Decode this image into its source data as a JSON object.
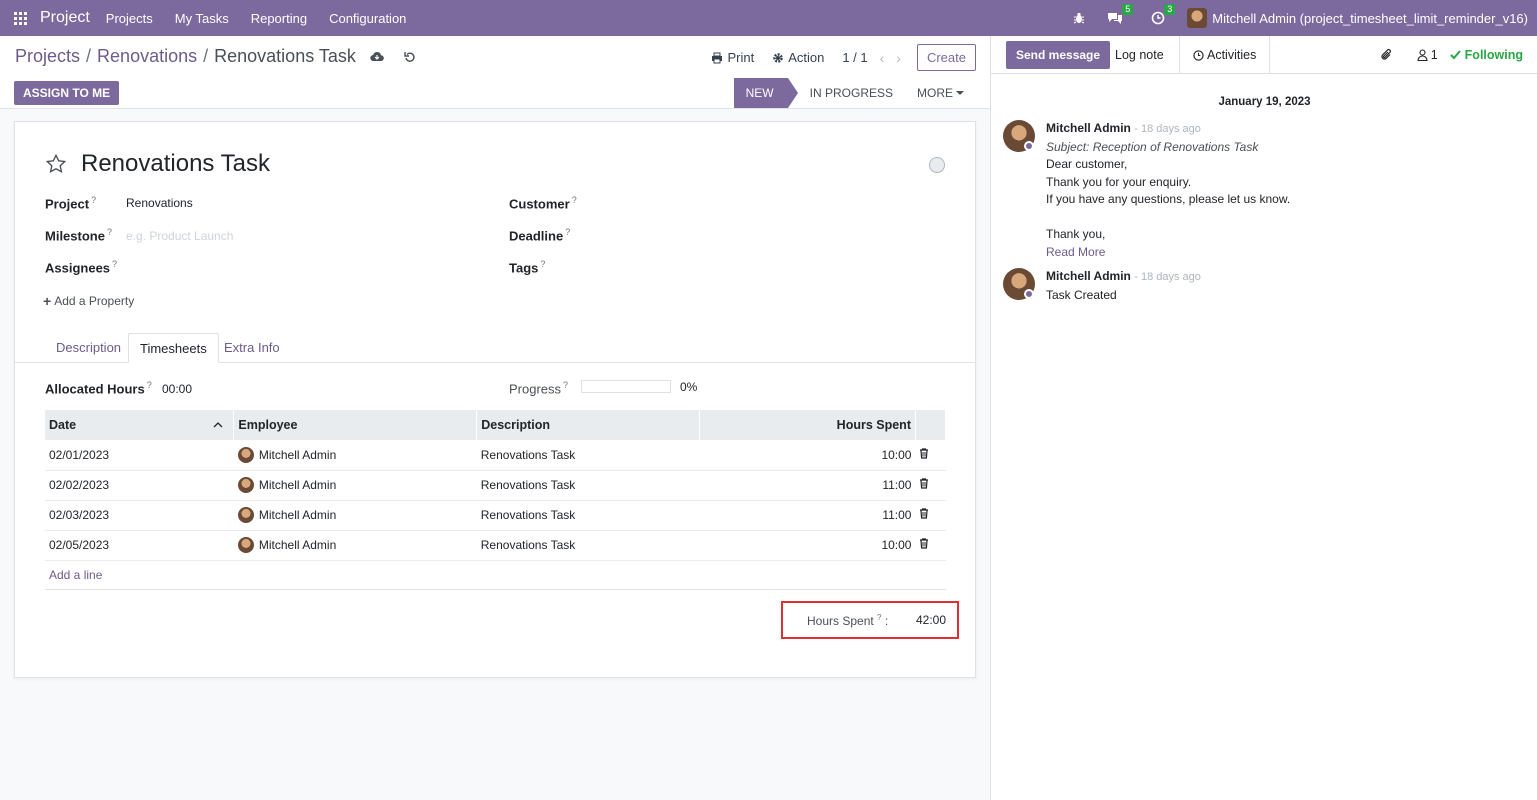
{
  "navbar": {
    "brand": "Project",
    "menu": [
      "Projects",
      "My Tasks",
      "Reporting",
      "Configuration"
    ],
    "messages_badge": "5",
    "activities_badge": "3",
    "user": "Mitchell Admin (project_timesheet_limit_reminder_v16)"
  },
  "breadcrumb": {
    "root": "Projects",
    "parent": "Renovations",
    "current": "Renovations Task"
  },
  "toolbar": {
    "print": "Print",
    "action": "Action",
    "pager": "1 / 1",
    "create": "Create",
    "assign": "ASSIGN TO ME"
  },
  "stages": {
    "new": "NEW",
    "in_progress": "IN PROGRESS",
    "more": "MORE"
  },
  "task": {
    "title": "Renovations Task",
    "fields": {
      "project_label": "Project",
      "project_value": "Renovations",
      "milestone_label": "Milestone",
      "milestone_placeholder": "e.g. Product Launch",
      "assignees_label": "Assignees",
      "customer_label": "Customer",
      "deadline_label": "Deadline",
      "tags_label": "Tags",
      "help_mark": "?"
    },
    "add_property": "Add a Property"
  },
  "tabs": [
    "Description",
    "Timesheets",
    "Extra Info"
  ],
  "timesheet": {
    "allocated_label": "Allocated Hours",
    "allocated_value": "00:00",
    "progress_label": "Progress",
    "progress_percent": 0,
    "progress_text": "0%",
    "columns": [
      "Date",
      "Employee",
      "Description",
      "Hours Spent"
    ],
    "rows": [
      {
        "date": "02/01/2023",
        "employee": "Mitchell Admin",
        "description": "Renovations Task",
        "hours": "10:00"
      },
      {
        "date": "02/02/2023",
        "employee": "Mitchell Admin",
        "description": "Renovations Task",
        "hours": "11:00"
      },
      {
        "date": "02/03/2023",
        "employee": "Mitchell Admin",
        "description": "Renovations Task",
        "hours": "11:00"
      },
      {
        "date": "02/05/2023",
        "employee": "Mitchell Admin",
        "description": "Renovations Task",
        "hours": "10:00"
      }
    ],
    "add_line": "Add a line",
    "total_label": "Hours Spent",
    "total_suffix": ":",
    "total_value": "42:00"
  },
  "chatter": {
    "send_message": "Send message",
    "log_note": "Log note",
    "activities": "Activities",
    "followers_count": "1",
    "following": "Following",
    "date_separator": "January 19, 2023",
    "messages": [
      {
        "author": "Mitchell Admin",
        "date": "- 18 days ago",
        "subject": "Subject: Reception of Renovations Task",
        "lines": [
          "Dear customer,",
          "Thank you for your enquiry.",
          "If you have any questions, please let us know.",
          "",
          "Thank you,"
        ],
        "read_more": "Read More"
      },
      {
        "author": "Mitchell Admin",
        "date": "- 18 days ago",
        "lines": [
          "Task Created"
        ]
      }
    ]
  },
  "colors": {
    "brand": "#7c6a9e",
    "success": "#28a745",
    "highlight": "#e03131"
  }
}
